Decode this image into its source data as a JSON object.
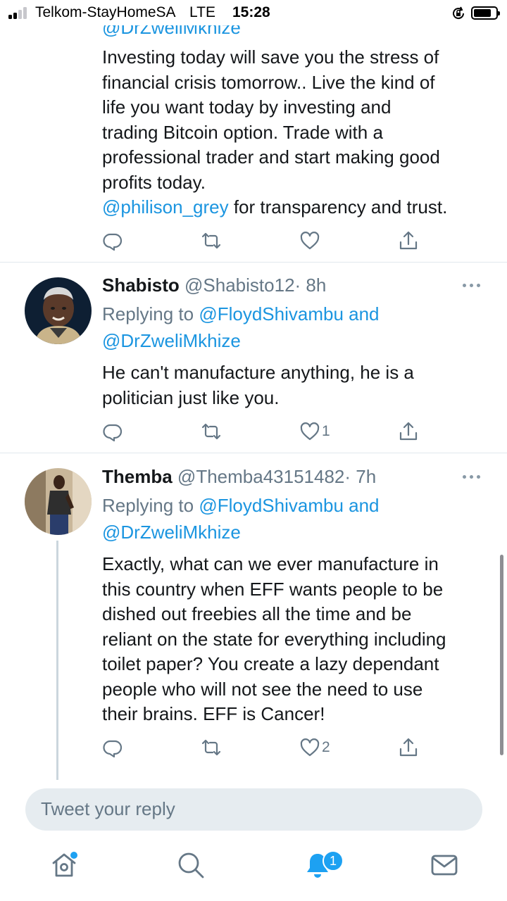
{
  "status_bar": {
    "carrier": "Telkom-StayHomeSA",
    "network": "LTE",
    "time": "15:28"
  },
  "top_tweet": {
    "partial_mention": "@DrZweliMkhize",
    "text_lines": [
      "Investing today will save you the stress of",
      "financial crisis tomorrow.. Live the kind of",
      "life you want today by investing and",
      "trading Bitcoin option. Trade with a",
      "professional trader and start making good",
      "profits today."
    ],
    "last_line_mention": "@philison_grey",
    "last_line_text": " for transparency and trust."
  },
  "tweets": [
    {
      "name": "Shabisto",
      "handle": "@Shabisto12",
      "time": "· 8h",
      "replying_to_label": "Replying to ",
      "replying_to_1": "@FloydShivambu and",
      "replying_to_2": "@DrZweliMkhize",
      "text_lines": [
        "He can't manufacture anything, he is  a",
        "politician just like you."
      ],
      "likes": "1"
    },
    {
      "name": "Themba",
      "handle": "@Themba43151482",
      "time": "· 7h",
      "replying_to_label": "Replying to ",
      "replying_to_1": "@FloydShivambu and",
      "replying_to_2": "@DrZweliMkhize",
      "text_lines": [
        "Exactly, what can we ever manufacture in",
        "this country when EFF wants people to be",
        "dished out freebies all the time and be",
        "reliant on the state for everything including",
        "toilet paper? You  create a lazy dependant",
        "people who will not see the need to use",
        "their brains. EFF is Cancer!"
      ],
      "likes": "2"
    }
  ],
  "composer": {
    "placeholder": "Tweet your reply"
  },
  "tab_bar": {
    "notification_count": "1"
  },
  "icons": {
    "reply": "reply-icon",
    "retweet": "retweet-icon",
    "like": "heart-icon",
    "share": "share-icon",
    "home": "home-icon",
    "search": "search-icon",
    "notifications": "bell-icon",
    "messages": "mail-icon"
  },
  "colors": {
    "link": "#1b95e0",
    "accent": "#1da1f2",
    "secondary_text": "#657786"
  }
}
